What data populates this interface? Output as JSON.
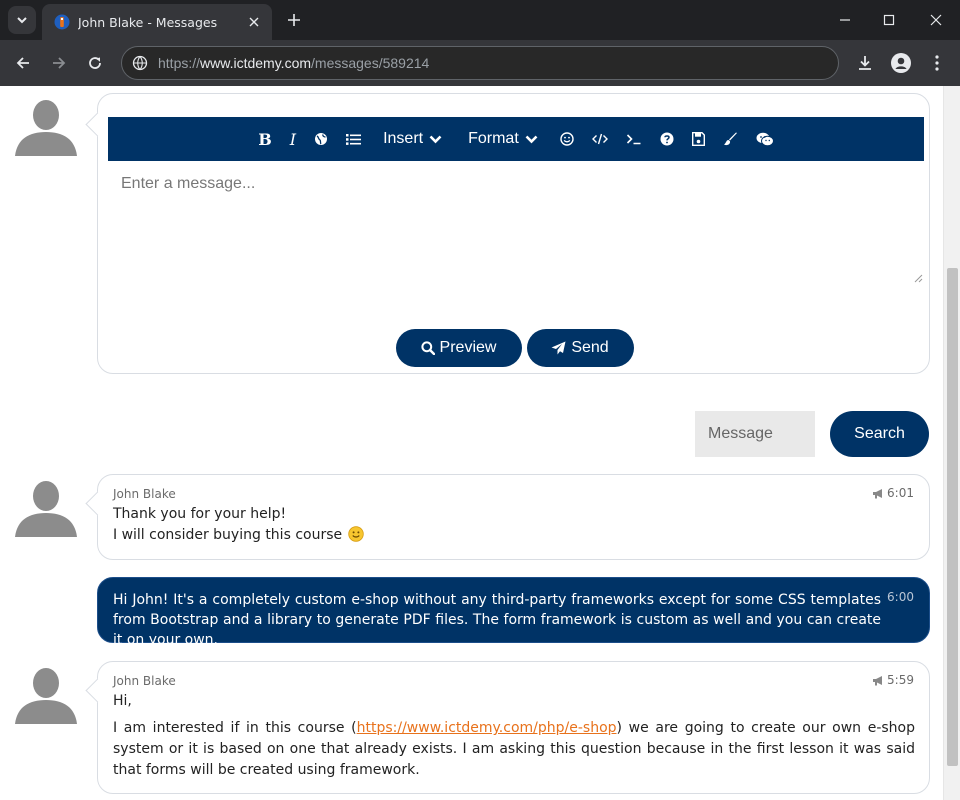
{
  "browser": {
    "tab_title": "John Blake - Messages",
    "url_scheme": "https://",
    "url_host": "www.ictdemy.com",
    "url_path": "/messages/589214"
  },
  "editor": {
    "toolbar": {
      "bold": "B",
      "italic": "I",
      "insert_menu": "Insert",
      "format_menu": "Format"
    },
    "placeholder": "Enter a message...",
    "preview_label": "Preview",
    "send_label": "Send"
  },
  "search": {
    "placeholder": "Message",
    "button_label": "Search"
  },
  "messages": [
    {
      "direction": "incoming",
      "author": "John Blake",
      "time": "6:01",
      "lines": [
        "Thank you for your help!",
        "I will consider buying this course"
      ],
      "emoji": "smiley"
    },
    {
      "direction": "outgoing",
      "time": "6:00",
      "text": "Hi John! It's a completely custom e-shop without any third-party frameworks except for some CSS templates from Bootstrap and a library to generate PDF files. The form framework is custom as well and you can create it on your own."
    },
    {
      "direction": "incoming",
      "author": "John Blake",
      "time": "5:59",
      "greeting": "Hi,",
      "text_before_link": "I am interested if in this course (",
      "link": "https://www.ictdemy.com/php/e-shop",
      "text_after_link": ") we are going to create our own e-shop system or it is based on one that already exists. I am asking this question because in the first lesson it was said that forms will be created using framework."
    }
  ],
  "colors": {
    "brand_navy": "#003366",
    "link_orange": "#e8721c",
    "bubble_border": "#d9dde3"
  }
}
